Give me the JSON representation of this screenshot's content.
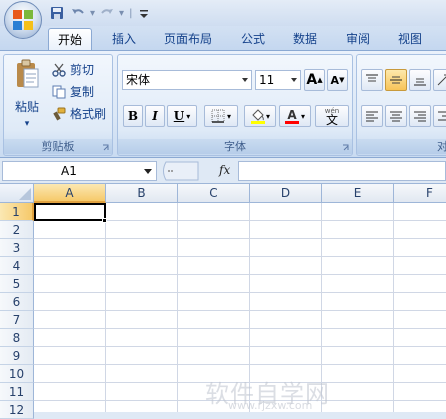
{
  "quick_access": {
    "save_icon": "save-icon",
    "undo_icon": "undo-icon",
    "redo_icon": "redo-icon",
    "customize_icon": "customize-toolbar-icon"
  },
  "tabs": [
    "开始",
    "插入",
    "页面布局",
    "公式",
    "数据",
    "审阅",
    "视图"
  ],
  "active_tab": "开始",
  "clipboard": {
    "paste": "粘贴",
    "cut": "剪切",
    "copy": "复制",
    "format_painter": "格式刷",
    "label": "剪贴板"
  },
  "font": {
    "name": "宋体",
    "size": "11",
    "grow": "A",
    "shrink": "A",
    "bold": "B",
    "italic": "I",
    "underline": "U",
    "color_letter": "A",
    "wen_top": "wén",
    "wen": "文",
    "label": "字体"
  },
  "alignment": {
    "label": "对"
  },
  "formula_bar": {
    "name_box": "A1",
    "fx": "fx",
    "value": ""
  },
  "columns": [
    "A",
    "B",
    "C",
    "D",
    "E",
    "F"
  ],
  "rows": [
    "1",
    "2",
    "3",
    "4",
    "5",
    "6",
    "7",
    "8",
    "9",
    "10",
    "11",
    "12"
  ],
  "selected_cell": "A1",
  "watermark": {
    "text": "软件自学网",
    "url": "www.rjzxw.com"
  },
  "colors": {
    "accent": "#f6c96a",
    "highlight": "#ffff00",
    "font_color": "#ff0000"
  }
}
